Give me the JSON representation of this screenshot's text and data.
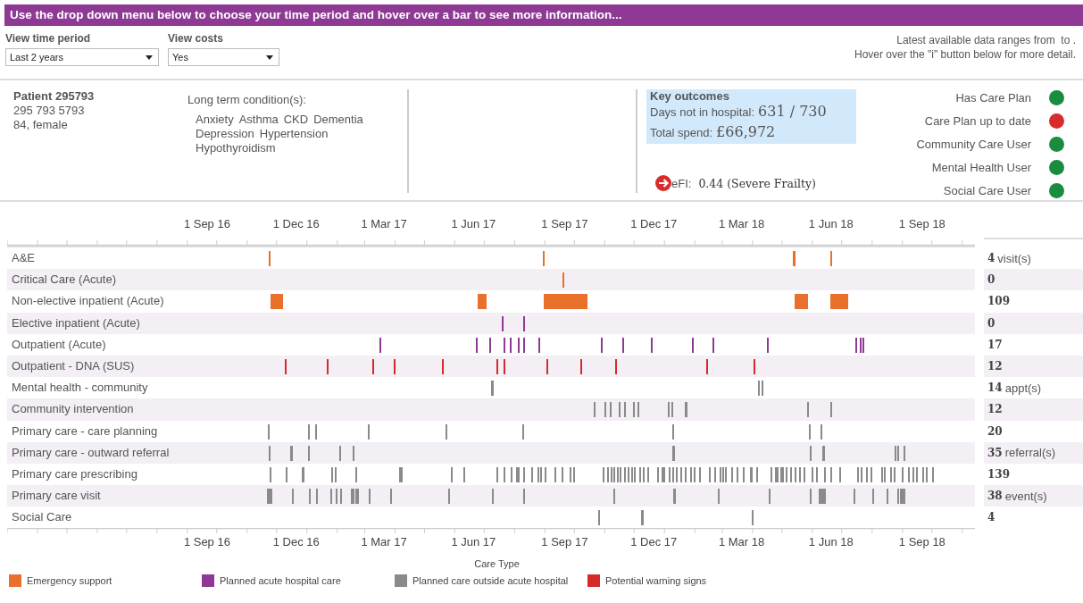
{
  "banner": "Use the drop down menu below to choose your time period and hover over a bar to see more information...",
  "controls": [
    {
      "label": "View time period",
      "value": "Last 2 years"
    },
    {
      "label": "View costs",
      "value": "Yes"
    }
  ],
  "data_note": [
    "Latest available data ranges from  to .",
    "Hover over the \"i\" button below for more detail."
  ],
  "patient": {
    "name": "Patient 295793",
    "number": "295 793 5793",
    "age_sex": "84, female"
  },
  "conditions": {
    "title": "Long term condition(s):",
    "items": [
      "Anxiety",
      "Asthma",
      "CKD",
      "Dementia",
      "Depression",
      "Hypertension",
      "Hypothyroidism"
    ]
  },
  "key_outcomes": {
    "title": "Key outcomes",
    "items": [
      {
        "label": "Days not in hospital:",
        "value": "631 / 730"
      },
      {
        "label": "Total spend:",
        "value": "£66,972"
      }
    ]
  },
  "efi": {
    "label": "eFI:",
    "value": "0.44 (Severe Frailty)"
  },
  "indicators": [
    {
      "label": "Has Care Plan",
      "color": "#1a8c3f"
    },
    {
      "label": "Care Plan up to date",
      "color": "#d92b2b"
    },
    {
      "label": "Community Care User",
      "color": "#1a8c3f"
    },
    {
      "label": "Mental Health User",
      "color": "#1a8c3f"
    },
    {
      "label": "Social Care User",
      "color": "#1a8c3f"
    }
  ],
  "timeline": {
    "top_axis": [
      "1 Sep 16",
      "1 Dec 16",
      "1 Mar 17",
      "1 Jun 17",
      "1 Sep 17",
      "1 Dec 17",
      "1 Mar 18",
      "1 Jun 18",
      "1 Sep 18"
    ],
    "rows": [
      {
        "label": "A&E",
        "color": "#e8702a",
        "count": "4",
        "unit": "visit(s)"
      },
      {
        "label": "Critical Care (Acute)",
        "color": "#e8702a",
        "count": "0"
      },
      {
        "label": "Non-elective inpatient (Acute)",
        "color": "#e8702a",
        "count": "109"
      },
      {
        "label": "Elective inpatient (Acute)",
        "color": "#8e3a94",
        "count": "0"
      },
      {
        "label": "Outpatient (Acute)",
        "color": "#8e3a94",
        "count": "17"
      },
      {
        "label": "Outpatient - DNA (SUS)",
        "color": "#d62a2a",
        "count": "12"
      },
      {
        "label": "Mental health - community",
        "color": "#8a8a8a",
        "count": "14",
        "unit": "appt(s)"
      },
      {
        "label": "Community intervention",
        "color": "#8a8a8a",
        "count": "12"
      },
      {
        "label": "Primary care - care planning",
        "color": "#8a8a8a",
        "count": "20"
      },
      {
        "label": "Primary care - outward referral",
        "color": "#8a8a8a",
        "count": "35",
        "unit": "referral(s)"
      },
      {
        "label": "Primary care prescribing",
        "color": "#8a8a8a",
        "count": "139"
      },
      {
        "label": "Primary care visit",
        "color": "#8a8a8a",
        "count": "38",
        "unit": "event(s)"
      },
      {
        "label": "Social Care",
        "color": "#8a8a8a",
        "count": "4"
      }
    ],
    "bottom_axis": [
      "1 Sep 16",
      "1 Dec 16",
      "1 Mar 17",
      "1 Jun 17",
      "1 Sep 17",
      "1 Dec 17",
      "1 Mar 18",
      "1 Jun 18",
      "1 Sep 18"
    ]
  },
  "legend": {
    "title": "Care Type",
    "items": [
      {
        "label": "Emergency support",
        "color": "#e8702a"
      },
      {
        "label": "Planned acute hospital care",
        "color": "#8e3a94"
      },
      {
        "label": "Planned care outside acute hospital",
        "color": "#8a8a8a"
      },
      {
        "label": "Potential warning signs",
        "color": "#d62a2a"
      }
    ]
  }
}
